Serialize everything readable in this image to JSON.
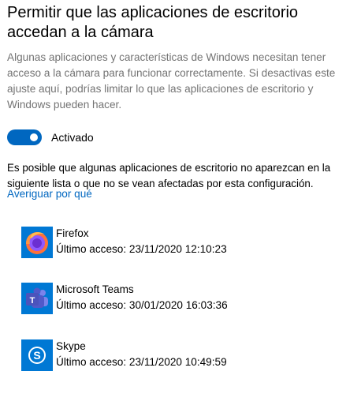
{
  "title": "Permitir que las aplicaciones de escritorio accedan a la cámara",
  "description": "Algunas aplicaciones y características de Windows necesitan tener acceso a la cámara para funcionar correctamente. Si desactivas este ajuste aquí, podrías limitar lo que las aplicaciones de escritorio y Windows pueden hacer.",
  "toggle": {
    "state": "on",
    "label": "Activado",
    "accent": "#0067c0"
  },
  "note": "Es posible que algunas aplicaciones de escritorio no aparezcan en la siguiente lista o que no se vean afectadas por esta configuración.",
  "link": "Averiguar por qué",
  "apps": [
    {
      "name": "Firefox",
      "last_access": "Último acceso: 23/11/2020 12:10:23",
      "icon": "firefox-icon"
    },
    {
      "name": "Microsoft Teams",
      "last_access": "Último acceso: 30/01/2020 16:03:36",
      "icon": "teams-icon"
    },
    {
      "name": "Skype",
      "last_access": "Último acceso: 23/11/2020 10:49:59",
      "icon": "skype-icon"
    }
  ]
}
